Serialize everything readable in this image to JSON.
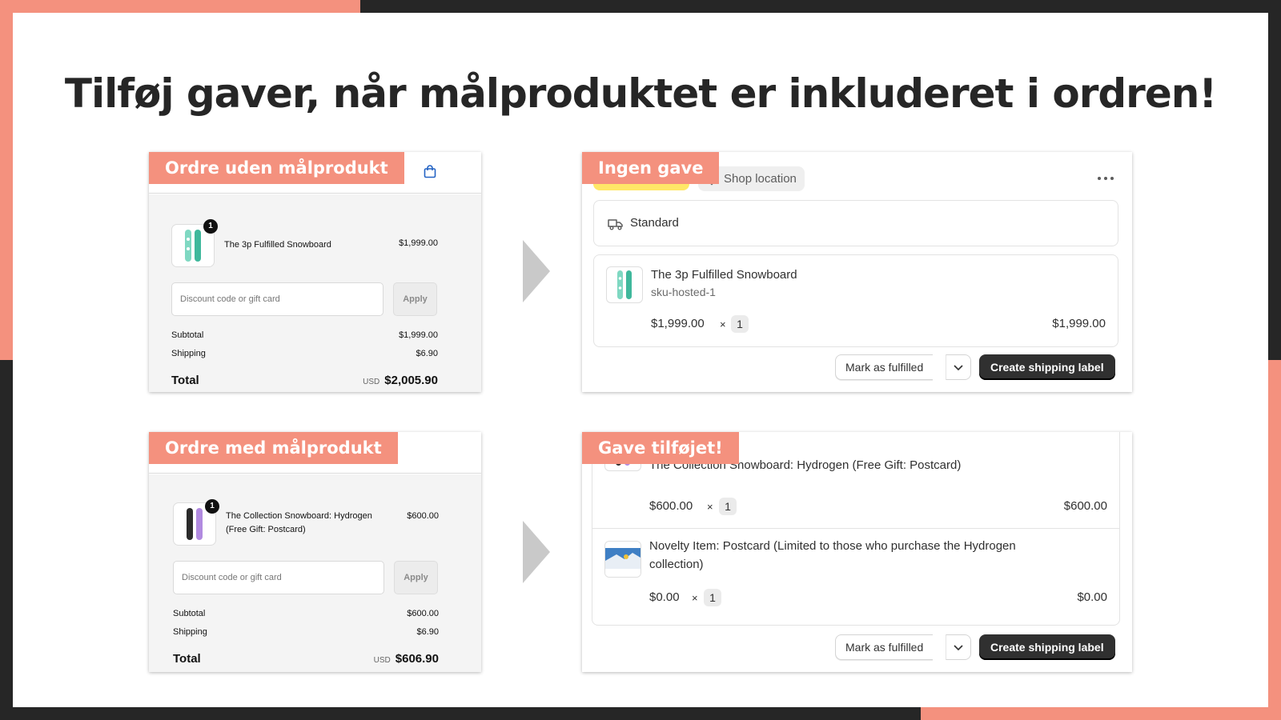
{
  "headline": "Tilføj gaver, når målproduktet er inkluderet i ordren!",
  "colors": {
    "accent": "#f4917e",
    "dark": "#262626",
    "white": "#ffffff"
  },
  "checkout_no_target": {
    "tag": "Ordre uden målprodukt",
    "item": {
      "name": "The 3p Fulfilled Snowboard",
      "price": "$1,999.00",
      "qty": "1"
    },
    "discount_placeholder": "Discount code or gift card",
    "apply_label": "Apply",
    "subtotal_label": "Subtotal",
    "subtotal": "$1,999.00",
    "shipping_label": "Shipping",
    "shipping": "$6.90",
    "total_label": "Total",
    "currency": "USD",
    "total": "$2,005.90"
  },
  "checkout_with_target": {
    "tag": "Ordre med målprodukt",
    "item": {
      "name_line1": "The Collection Snowboard: Hydrogen",
      "name_line2": "(Free Gift: Postcard)",
      "price": "$600.00",
      "qty": "1"
    },
    "discount_placeholder": "Discount code or gift card",
    "apply_label": "Apply",
    "subtotal_label": "Subtotal",
    "subtotal": "$600.00",
    "shipping_label": "Shipping",
    "shipping": "$6.90",
    "total_label": "Total",
    "currency": "USD",
    "total": "$606.90"
  },
  "admin_no_gift": {
    "tag": "Ingen gave",
    "location_label": "Shop location",
    "delivery": "Standard",
    "item": {
      "title": "The 3p Fulfilled Snowboard",
      "sku": "sku-hosted-1",
      "price": "$1,999.00",
      "times": "×",
      "qty": "1",
      "total": "$1,999.00"
    },
    "mark_label": "Mark as fulfilled",
    "ship_label": "Create shipping label"
  },
  "admin_gift": {
    "tag": "Gave tilføjet!",
    "item1": {
      "title": "The Collection Snowboard: Hydrogen (Free Gift: Postcard)",
      "price": "$600.00",
      "times": "×",
      "qty": "1",
      "total": "$600.00"
    },
    "item2": {
      "title_line1": "Novelty Item: Postcard (Limited to those who purchase the Hydrogen",
      "title_line2": "collection)",
      "price": "$0.00",
      "times": "×",
      "qty": "1",
      "total": "$0.00"
    },
    "mark_label": "Mark as fulfilled",
    "ship_label": "Create shipping label"
  }
}
